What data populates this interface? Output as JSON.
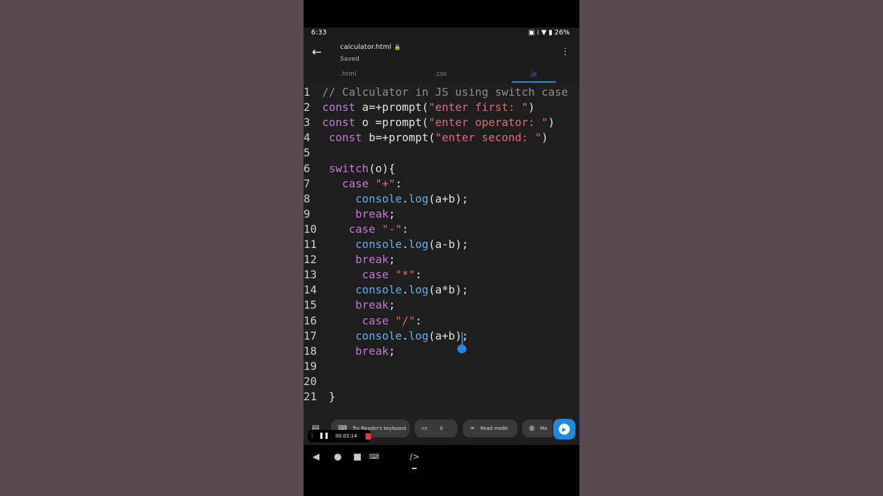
{
  "status": {
    "time": "6:33",
    "battery": "26%",
    "icons": [
      "cast-icon",
      "vibrate-icon",
      "wifi-icon",
      "battery-icon"
    ]
  },
  "appbar": {
    "filename": "calculator.html",
    "status": "Saved"
  },
  "tabs": [
    ".html",
    ".css",
    ".js"
  ],
  "code_lines": [
    {
      "n": "1",
      "text": "// Calculator in JS using switch case"
    },
    {
      "n": "2",
      "text": "const a=+prompt(\"enter first: \")"
    },
    {
      "n": "3",
      "text": "const o =prompt(\"enter operator: \")"
    },
    {
      "n": "4",
      "text": " const b=+prompt(\"enter second: \")"
    },
    {
      "n": "5",
      "text": ""
    },
    {
      "n": "6",
      "text": " switch(o){"
    },
    {
      "n": "7",
      "text": "   case \"+\":"
    },
    {
      "n": "8",
      "text": "     console.log(a+b);"
    },
    {
      "n": "9",
      "text": "     break;"
    },
    {
      "n": "10",
      "text": "    case \"-\":"
    },
    {
      "n": "11",
      "text": "     console.log(a-b);"
    },
    {
      "n": "12",
      "text": "     break;"
    },
    {
      "n": "13",
      "text": "      case \"*\":"
    },
    {
      "n": "14",
      "text": "     console.log(a*b);"
    },
    {
      "n": "15",
      "text": "     break;"
    },
    {
      "n": "16",
      "text": "      case \"/\":"
    },
    {
      "n": "17",
      "text": "     console.log(a+b);"
    },
    {
      "n": "18",
      "text": "     break;"
    },
    {
      "n": "19",
      "text": ""
    },
    {
      "n": "20",
      "text": ""
    },
    {
      "n": "21",
      "text": " }"
    }
  ],
  "toolbar": {
    "keyboard": "Try Reader's keyboard",
    "comments": "0",
    "read_mode": "Read mode",
    "more": "Ma"
  },
  "recording": {
    "time": "00:02:14"
  }
}
